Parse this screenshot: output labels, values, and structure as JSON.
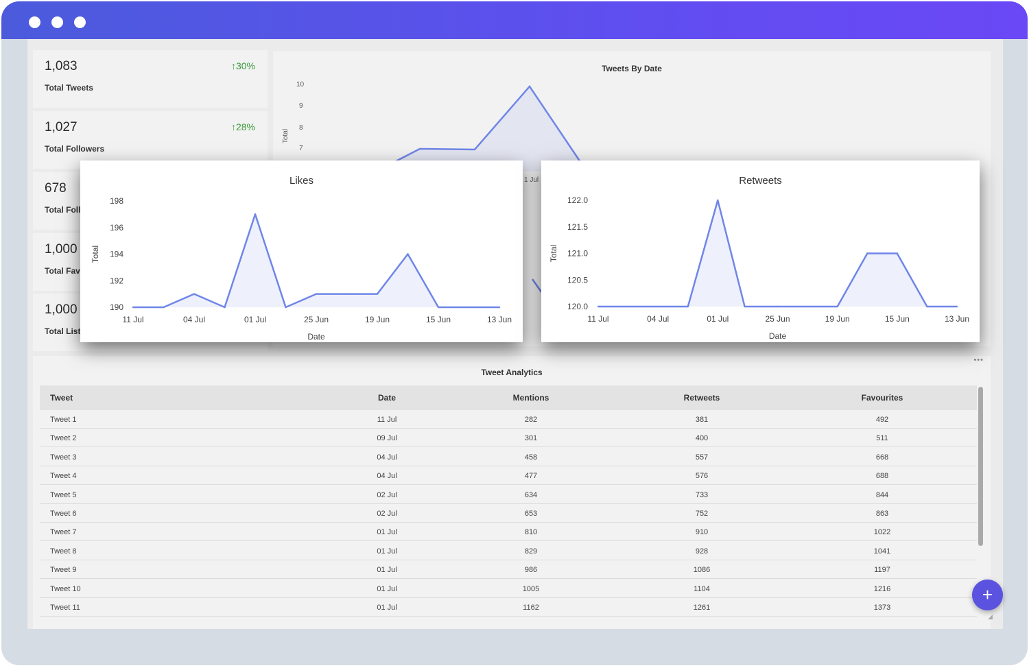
{
  "kpis": [
    {
      "value": "1,083",
      "change": "↑30%",
      "label": "Total Tweets"
    },
    {
      "value": "1,027",
      "change": "↑28%",
      "label": "Total Followers"
    },
    {
      "value": "678",
      "change": "",
      "label": "Total Foll"
    },
    {
      "value": "1,000",
      "change": "",
      "label": "Total Fav"
    },
    {
      "value": "1,000",
      "change": "",
      "label": "Total Lists"
    }
  ],
  "background_chart": {
    "title": "Tweets By Date",
    "ylabel": "Total",
    "y_ticks": [
      "10",
      "9",
      "8",
      "7"
    ],
    "x_tick_partial": "1 Jul",
    "xlabel_partial": "Date"
  },
  "chart_data": [
    {
      "type": "area",
      "title": "Likes",
      "xlabel": "Date",
      "ylabel": "Total",
      "x_ticks": [
        "11 Jul",
        "04 Jul",
        "01 Jul",
        "25 Jun",
        "19 Jun",
        "15 Jun",
        "13 Jun"
      ],
      "y_ticks": [
        "198",
        "196",
        "194",
        "192",
        "190"
      ],
      "ylim": [
        190,
        198
      ],
      "x": [
        0,
        0.5,
        1,
        1.5,
        2,
        2.5,
        3,
        3.5,
        4,
        4.5,
        5,
        5.5,
        6
      ],
      "values": [
        190,
        190,
        191,
        190,
        197,
        190,
        191,
        191,
        191,
        194,
        190,
        190,
        190
      ],
      "color": "#6f86e8"
    },
    {
      "type": "area",
      "title": "Retweets",
      "xlabel": "Date",
      "ylabel": "Total",
      "x_ticks": [
        "11 Jul",
        "04 Jul",
        "01 Jul",
        "25 Jun",
        "19 Jun",
        "15 Jun",
        "13 Jun"
      ],
      "y_ticks": [
        "122.0",
        "121.5",
        "121.0",
        "120.5",
        "120.0"
      ],
      "ylim": [
        120,
        122
      ],
      "x": [
        0,
        1.5,
        2,
        2.45,
        3,
        4,
        4.5,
        4.75,
        5,
        5.5,
        6
      ],
      "values": [
        120,
        120,
        122,
        120,
        120,
        120,
        121,
        121,
        121,
        120,
        120
      ],
      "color": "#6f86e8"
    }
  ],
  "table": {
    "title": "Tweet Analytics",
    "more_icon": "•••",
    "columns": [
      "Tweet",
      "Date",
      "Mentions",
      "Retweets",
      "Favourites"
    ],
    "rows": [
      [
        "Tweet 1",
        "11 Jul",
        "282",
        "381",
        "492"
      ],
      [
        "Tweet 2",
        "09 Jul",
        "301",
        "400",
        "511"
      ],
      [
        "Tweet 3",
        "04 Jul",
        "458",
        "557",
        "668"
      ],
      [
        "Tweet 4",
        "04 Jul",
        "477",
        "576",
        "688"
      ],
      [
        "Tweet 5",
        "02 Jul",
        "634",
        "733",
        "844"
      ],
      [
        "Tweet 6",
        "02 Jul",
        "653",
        "752",
        "863"
      ],
      [
        "Tweet 7",
        "01 Jul",
        "810",
        "910",
        "1022"
      ],
      [
        "Tweet 8",
        "01 Jul",
        "829",
        "928",
        "1041"
      ],
      [
        "Tweet 9",
        "01 Jul",
        "986",
        "1086",
        "1197"
      ],
      [
        "Tweet 10",
        "01 Jul",
        "1005",
        "1104",
        "1216"
      ],
      [
        "Tweet 11",
        "01 Jul",
        "1162",
        "1261",
        "1373"
      ]
    ]
  },
  "fab_label": "+",
  "colors": {
    "titlebar_start": "#4b5bdc",
    "titlebar_end": "#6a48f5",
    "accent": "#5b52e0",
    "positive": "#3a9a3a",
    "series": "#6f86e8"
  }
}
